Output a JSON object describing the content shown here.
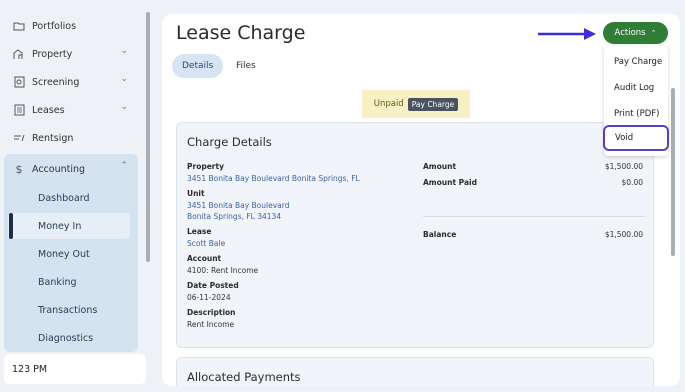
{
  "sidebar": {
    "items": [
      {
        "label": "Portfolios",
        "icon": "folder-icon"
      },
      {
        "label": "Property",
        "icon": "building-icon",
        "chevron": "⌄"
      },
      {
        "label": "Screening",
        "icon": "screening-icon",
        "chevron": "⌄"
      },
      {
        "label": "Leases",
        "icon": "document-icon",
        "chevron": "⌄"
      },
      {
        "label": "Rentsign",
        "icon": "sign-icon"
      },
      {
        "label": "Accounting",
        "icon": "dollar-icon",
        "chevron": "⌃"
      }
    ],
    "accounting_sub": [
      {
        "label": "Dashboard"
      },
      {
        "label": "Money In"
      },
      {
        "label": "Money Out"
      },
      {
        "label": "Banking"
      },
      {
        "label": "Transactions"
      },
      {
        "label": "Diagnostics"
      }
    ],
    "time": "123 PM"
  },
  "header": {
    "title": "Lease Charge",
    "tabs": [
      {
        "label": "Details"
      },
      {
        "label": "Files"
      }
    ]
  },
  "status": {
    "label": "Unpaid",
    "button": "Pay Charge"
  },
  "actions": {
    "label": "Actions",
    "caret": "⌃",
    "menu": [
      {
        "label": "Pay Charge"
      },
      {
        "label": "Audit Log"
      },
      {
        "label": "Print (PDF)"
      },
      {
        "label": "Void"
      }
    ]
  },
  "charge_details": {
    "title": "Charge Details",
    "property_label": "Property",
    "property_value": "3451 Bonita Bay Boulevard Bonita Springs, FL",
    "unit_label": "Unit",
    "unit_line1": "3451 Bonita Bay Boulevard",
    "unit_line2": "Bonita Springs, FL 34134",
    "lease_label": "Lease",
    "lease_value": "Scott Bale",
    "account_label": "Account",
    "account_value": "4100: Rent Income",
    "date_label": "Date Posted",
    "date_value": "06-11-2024",
    "desc_label": "Description",
    "desc_value": "Rent Income",
    "amount_label": "Amount",
    "amount_value": "$1,500.00",
    "amount_paid_label": "Amount Paid",
    "amount_paid_value": "$0.00",
    "balance_label": "Balance",
    "balance_value": "$1,500.00"
  },
  "allocated": {
    "title": "Allocated Payments"
  },
  "colors": {
    "accent_green": "#2f7d37",
    "highlight_purple": "#5b3cc4",
    "arrow_blue": "#3b2fd9"
  }
}
